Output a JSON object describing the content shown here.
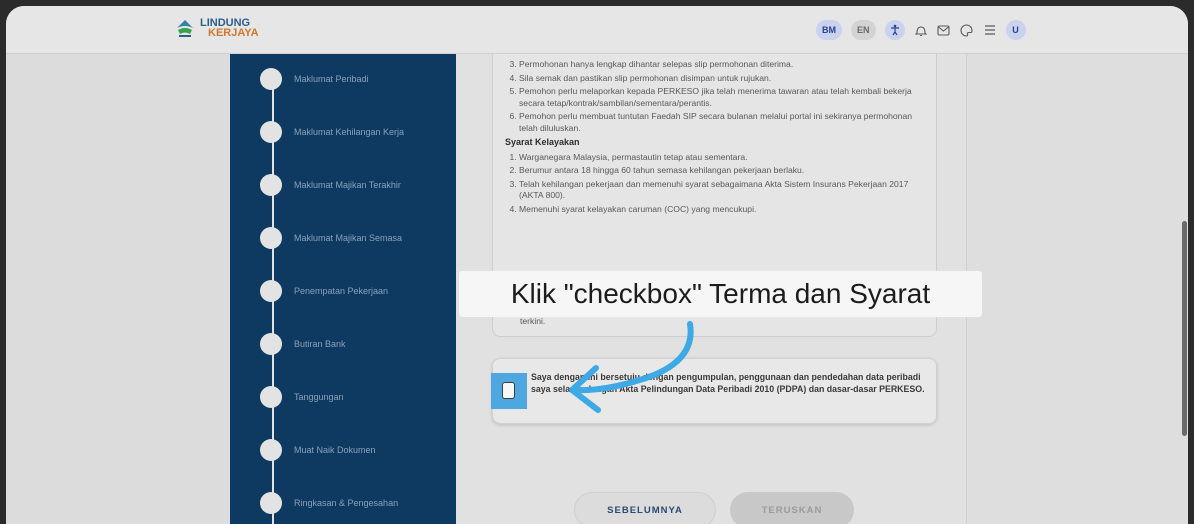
{
  "header": {
    "logo_line1": "LINDUNG",
    "logo_line2": "KERJAYA",
    "lang_bm": "BM",
    "lang_en": "EN",
    "avatar_initial": "U"
  },
  "sidebar": {
    "steps": [
      {
        "label": "Maklumat Peribadi"
      },
      {
        "label": "Maklumat Kehilangan Kerja"
      },
      {
        "label": "Maklumat Majikan Terakhir"
      },
      {
        "label": "Maklumat Majikan Semasa"
      },
      {
        "label": "Penempatan Pekerjaan"
      },
      {
        "label": "Butiran Bank"
      },
      {
        "label": "Tanggungan"
      },
      {
        "label": "Muat Naik Dokumen"
      },
      {
        "label": "Ringkasan & Pengesahan"
      }
    ]
  },
  "terms": {
    "items_top": [
      "Permohonan hanya lengkap dihantar selepas slip permohonan diterima.",
      "Sila semak dan pastikan slip permohonan disimpan untuk rujukan.",
      "Pemohon perlu melaporkan kepada PERKESO jika telah menerima tawaran atau telah kembali bekerja secara tetap/kontrak/sambilan/sementara/perantis.",
      "Pemohon perlu membuat tuntutan Faedah SIP secara bulanan melalui portal ini sekiranya permohonan telah diluluskan."
    ],
    "eligibility_title": "Syarat Kelayakan",
    "eligibility_items": [
      "Warganegara Malaysia, permastautin tetap atau sementara.",
      "Berumur antara 18 hingga 60 tahun semasa kehilangan pekerjaan berlaku.",
      "Telah kehilangan pekerjaan dan memenuhi syarat sebagaimana Akta Sistem Insurans Pekerjaan 2017 (AKTA 800).",
      "Memenuhi syarat kelayakan caruman (COC) yang mencukupi."
    ],
    "hidden_fragment": "terkini."
  },
  "consent": {
    "text": "Saya dengan ini bersetuju dengan pengumpulan, penggunaan dan pendedahan data peribadi saya selaras dengan Akta Pelindungan Data Peribadi 2010 (PDPA) dan dasar-dasar PERKESO."
  },
  "buttons": {
    "prev": "SEBELUMNYA",
    "next": "TERUSKAN"
  },
  "tooltip": {
    "text": "Klik \"checkbox\" Terma dan Syarat"
  },
  "colors": {
    "sidebar_bg": "#0e3a62",
    "highlight": "#4ea7e0",
    "primary_text": "#2c4a73"
  }
}
